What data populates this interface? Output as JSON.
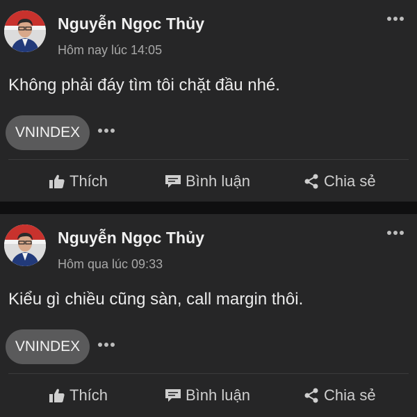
{
  "posts": [
    {
      "author": "Nguyễn Ngọc Thủy",
      "timestamp": "Hôm nay lúc 14:05",
      "content": "Không phải đáy tìm tôi chặt đầu nhé.",
      "tag": "VNINDEX",
      "actions": {
        "like": "Thích",
        "comment": "Bình luận",
        "share": "Chia sẻ"
      }
    },
    {
      "author": "Nguyễn Ngọc Thủy",
      "timestamp": "Hôm qua lúc 09:33",
      "content": "Kiểu gì chiều cũng sàn, call margin thôi.",
      "tag": "VNINDEX",
      "actions": {
        "like": "Thích",
        "comment": "Bình luận",
        "share": "Chia sẻ"
      }
    }
  ],
  "icons": {
    "more": "more-horizontal-icon",
    "like": "thumbs-up-icon",
    "comment": "comment-icon",
    "share": "share-icon"
  },
  "colors": {
    "background": "#0f0f10",
    "card": "#262627",
    "tag": "#5a5a5b",
    "muted_text": "#a8a8a8"
  }
}
